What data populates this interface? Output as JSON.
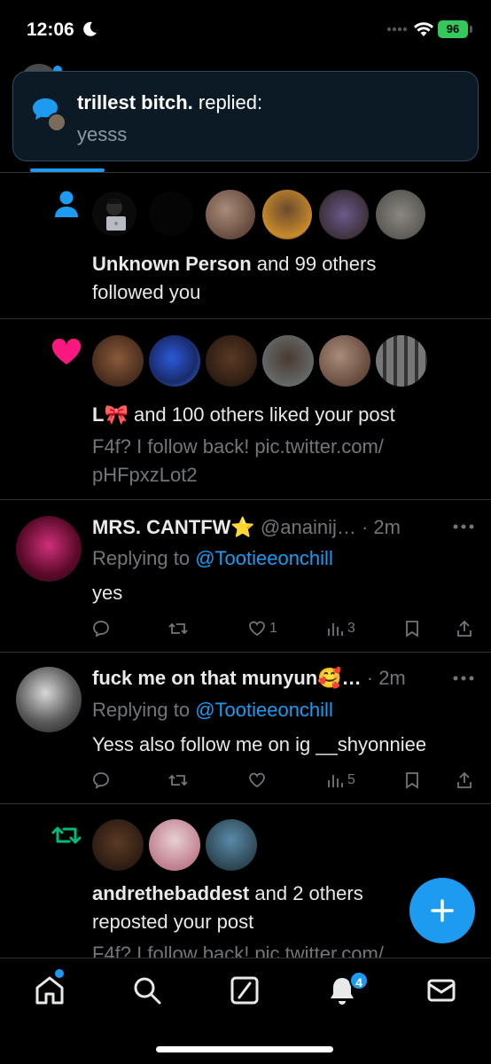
{
  "status_bar": {
    "time": "12:06",
    "battery": "96"
  },
  "banner": {
    "author": "trillest bitch.",
    "action": " replied:",
    "message": "yesss"
  },
  "notifications": [
    {
      "type": "follow",
      "bold": "Unknown Person",
      "rest": " and 99 others",
      "line2": "followed you"
    },
    {
      "type": "like",
      "bold": "L🎀",
      "rest": " and 100 others liked your post",
      "preview1": "F4f? I follow back! pic.twitter.com/",
      "preview2": "pHFpxzLot2"
    }
  ],
  "tweets": [
    {
      "name": "MRS. CANTFW⭐",
      "handle": " @anainij…",
      "time": " · 2m",
      "replying_prefix": "Replying to ",
      "replying_handle": "@Tootieeonchill",
      "text": "yes",
      "likes": "1",
      "views": "3"
    },
    {
      "name": "fuck me on that munyun🥰…",
      "handle": "",
      "time": " · 2m",
      "replying_prefix": "Replying to ",
      "replying_handle": "@Tootieeonchill",
      "text": "Yess  also follow me on ig __shyonniee",
      "likes": "",
      "views": "5"
    }
  ],
  "repost": {
    "bold": "andrethebaddest",
    "rest": " and 2 others",
    "line2": "reposted your post",
    "preview": "F4f? I follow back! pic.twitter.com/"
  },
  "nav": {
    "notification_badge": "4"
  },
  "colors": {
    "accent": "#1d9bf0",
    "like": "#f91880",
    "repost": "#00ba7c",
    "background": "#000000"
  }
}
